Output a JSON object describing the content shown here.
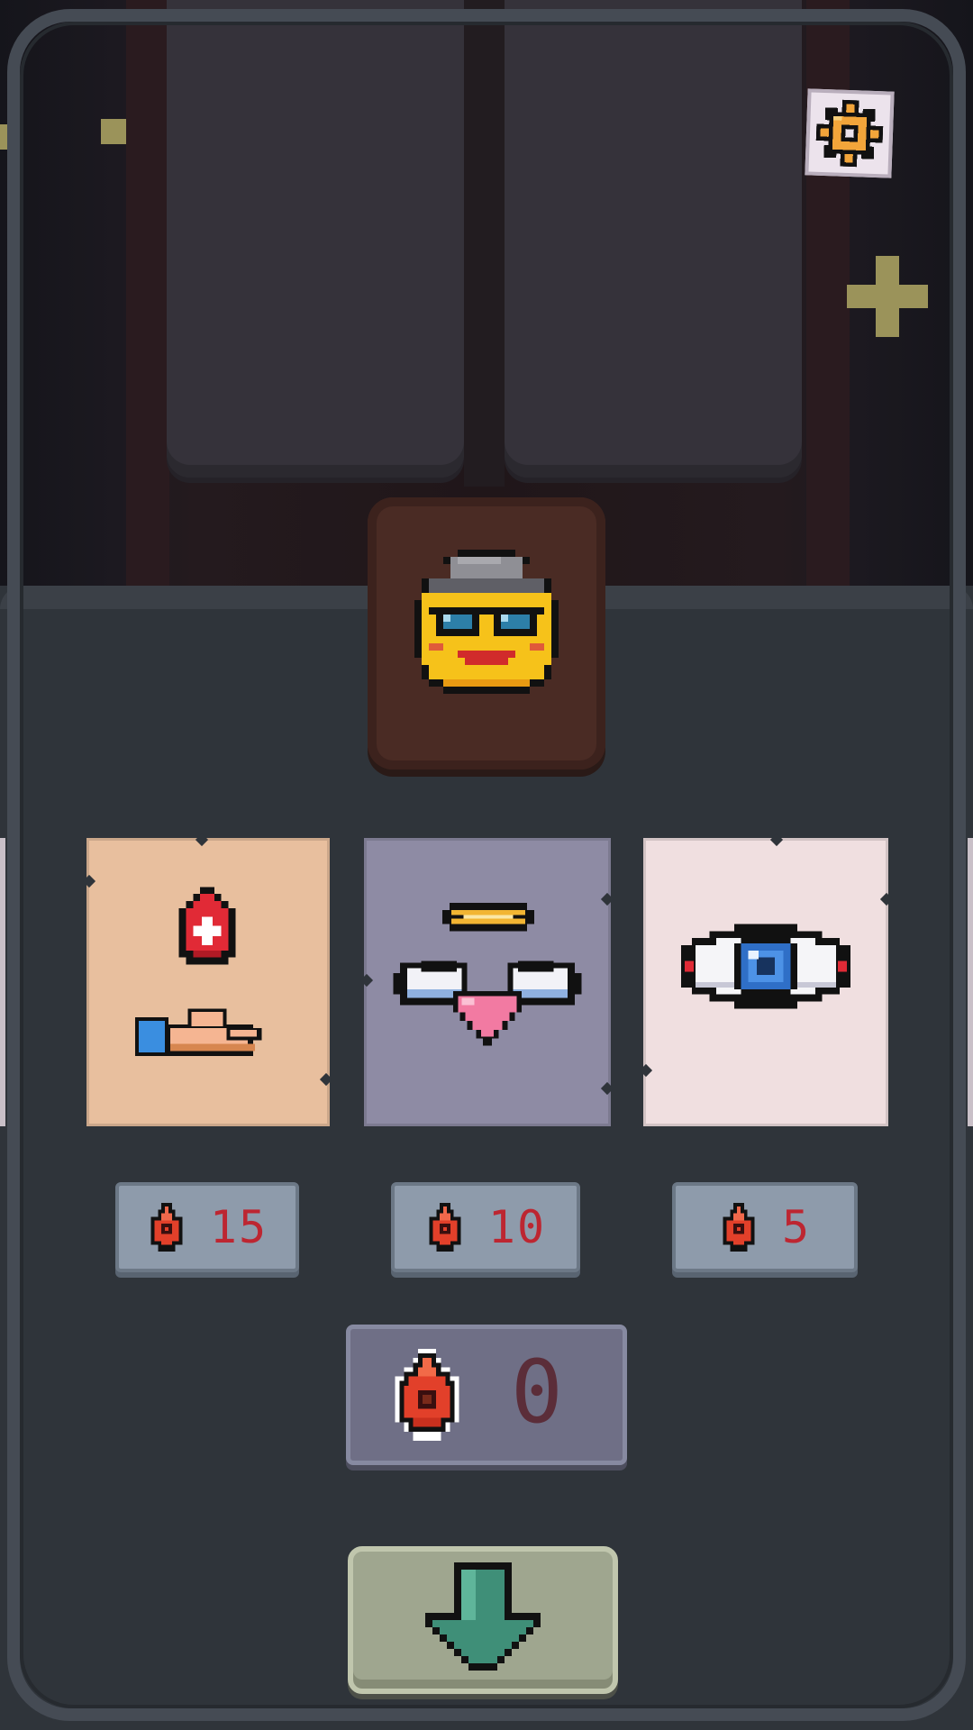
{
  "settings": {
    "icon": "gear-icon"
  },
  "character": {
    "icon": "smiley-with-hat-and-sunglasses-icon"
  },
  "shop": {
    "items": [
      {
        "icon": "blood-drop-hand-icon",
        "price": "15",
        "price_icon": "blood-drop-icon"
      },
      {
        "icon": "winged-heart-halo-icon",
        "price": "10",
        "price_icon": "blood-drop-icon"
      },
      {
        "icon": "eye-icon",
        "price": "5",
        "price_icon": "blood-drop-icon"
      }
    ]
  },
  "currency": {
    "icon": "blood-drop-icon",
    "amount": "0"
  },
  "proceed": {
    "icon": "down-arrow-icon"
  },
  "colors": {
    "card_1": "#e8bf9e",
    "card_2": "#8e8ba4",
    "card_3": "#f0dfe0",
    "price_text": "#bd2631",
    "arrow": "#3f8f78"
  }
}
